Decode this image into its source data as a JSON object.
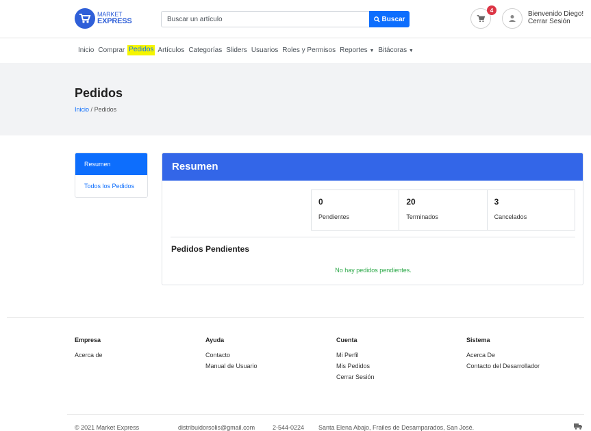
{
  "brand": {
    "line1": "MARKET",
    "line2": "EXPRESS"
  },
  "search": {
    "placeholder": "Buscar un artículo",
    "button_label": "Buscar"
  },
  "cart": {
    "count": "4"
  },
  "user": {
    "greeting": "Bienvenido Diego!",
    "logout": "Cerrar Sesión"
  },
  "nav": {
    "items": [
      "Inicio",
      "Comprar",
      "Pedidos",
      "Artículos",
      "Categorías",
      "Sliders",
      "Usuarios",
      "Roles y Permisos",
      "Reportes",
      "Bitácoras"
    ],
    "active": "Pedidos"
  },
  "page": {
    "title": "Pedidos",
    "breadcrumb_home": "Inicio",
    "breadcrumb_sep": "/",
    "breadcrumb_current": "Pedidos"
  },
  "sidebar": {
    "items": [
      {
        "label": "Resumen"
      },
      {
        "label": "Todos los Pedidos"
      }
    ]
  },
  "card": {
    "title": "Resumen",
    "stats": [
      {
        "value": "0",
        "label": "Pendientes"
      },
      {
        "value": "20",
        "label": "Terminados"
      },
      {
        "value": "3",
        "label": "Cancelados"
      }
    ],
    "pending_title": "Pedidos Pendientes",
    "pending_empty": "No hay pedidos pendientes."
  },
  "footer": {
    "columns": [
      {
        "heading": "Empresa",
        "links": [
          "Acerca de"
        ]
      },
      {
        "heading": "Ayuda",
        "links": [
          "Contacto",
          "Manual de Usuario"
        ]
      },
      {
        "heading": "Cuenta",
        "links": [
          "Mi Perfil",
          "Mis Pedidos",
          "Cerrar Sesión"
        ]
      },
      {
        "heading": "Sistema",
        "links": [
          "Acerca De",
          "Contacto del Desarrollador"
        ]
      }
    ],
    "copyright": "© 2021 Market Express",
    "email": "distribuidorsolis@gmail.com",
    "phone": "2-544-0224",
    "address": "Santa Elena Abajo, Frailes de Desamparados, San José."
  },
  "colors": {
    "primary": "#0d6efd",
    "header_blue": "#3366e8",
    "badge_red": "#dc3545",
    "success": "#28a745",
    "highlight": "#f5f500"
  },
  "icons": {
    "logo": "cart-logo-icon",
    "search": "search-icon",
    "cart": "cart-icon",
    "user": "user-icon",
    "truck": "truck-icon"
  }
}
